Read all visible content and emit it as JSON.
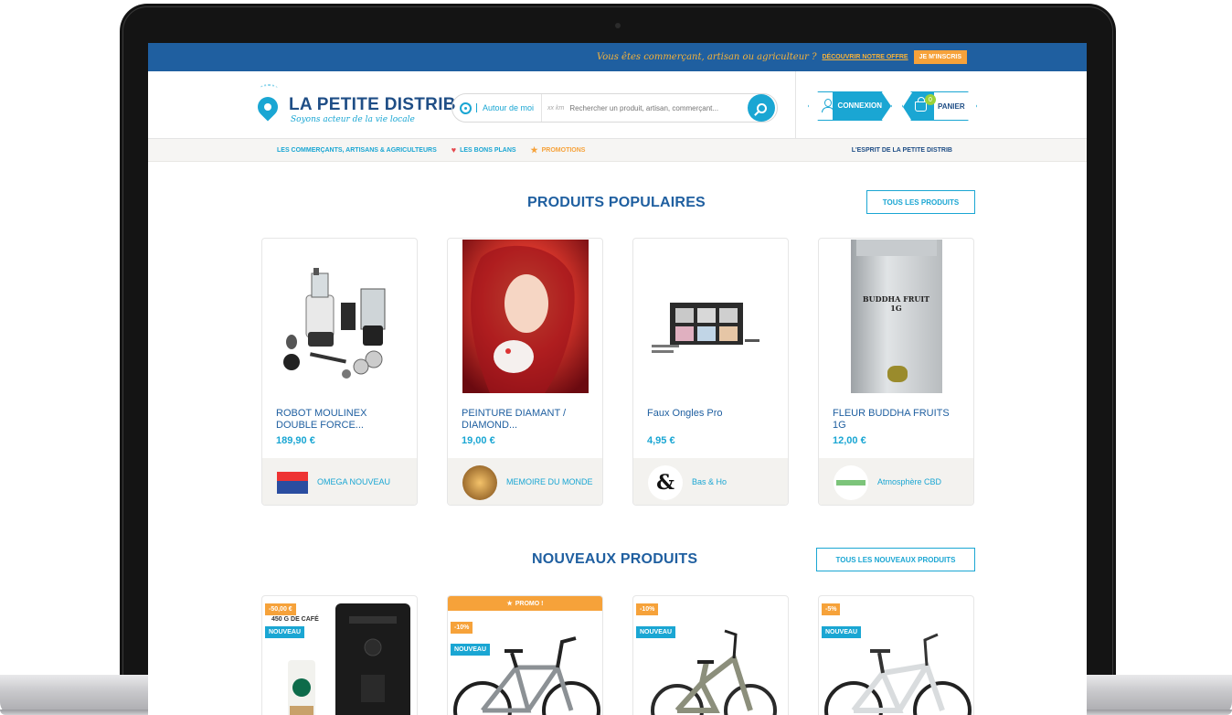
{
  "topbar": {
    "pitch": "Vous êtes commerçant, artisan ou agriculteur ?",
    "offer_link": "DÉCOUVRIR NOTRE OFFRE",
    "signup_button": "JE M'INSCRIS"
  },
  "header": {
    "logo_title": "LA PETITE DISTRIB",
    "logo_tagline": "Soyons acteur de la vie locale",
    "location_button": "Autour de moi",
    "radius_label": "xx km",
    "search_placeholder": "Rechercher un produit, artisan, commerçant...",
    "login_button": "CONNEXION",
    "cart_button": "PANIER",
    "cart_count": "0"
  },
  "nav": {
    "merchants": "LES COMMERÇANTS, ARTISANS & AGRICULTEURS",
    "deals": "LES BONS PLANS",
    "promotions": "PROMOTIONS",
    "spirit": "L'ESPRIT DE LA PETITE DISTRIB"
  },
  "popular": {
    "title": "PRODUITS POPULAIRES",
    "all_button": "TOUS LES PRODUITS",
    "products": [
      {
        "name": "ROBOT MOULINEX DOUBLE FORCE...",
        "price": "189,90 €",
        "shop": "OMEGA NOUVEAU"
      },
      {
        "name": "PEINTURE DIAMANT / DIAMOND...",
        "price": "19,00 €",
        "shop": "MEMOIRE DU MONDE"
      },
      {
        "name": "Faux Ongles Pro",
        "price": "4,95 €",
        "shop": "Bas & Ho"
      },
      {
        "name": "FLEUR BUDDHA FRUITS 1G",
        "price": "12,00 €",
        "shop": "Atmosphère CBD",
        "image_label": "BUDDHA FRUIT 1G"
      }
    ]
  },
  "new_products": {
    "title": "NOUVEAUX PRODUITS",
    "all_button": "TOUS LES NOUVEAUX PRODUITS",
    "promo_band": "PROMO !",
    "items": [
      {
        "discount": "-50,00 €",
        "badge": "NOUVEAU",
        "image_label": "450 G DE CAFÉ"
      },
      {
        "discount": "-10%",
        "badge": "NOUVEAU"
      },
      {
        "discount": "-10%",
        "badge": "NOUVEAU"
      },
      {
        "discount": "-5%",
        "badge": "NOUVEAU"
      }
    ]
  },
  "colors": {
    "brand_blue": "#1f5fa0",
    "accent_cyan": "#1aa6d3",
    "accent_orange": "#f6a23a"
  }
}
